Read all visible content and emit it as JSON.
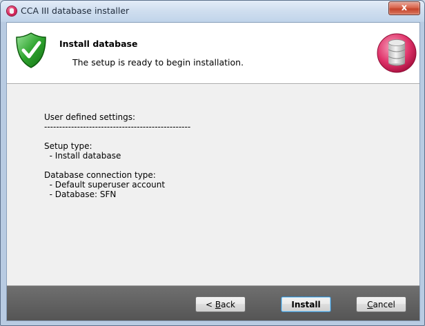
{
  "window": {
    "title": "CCA III database installer",
    "close_glyph": "x"
  },
  "header": {
    "title": "Install database",
    "subtitle": "The setup is ready to begin installation.",
    "left_icon": "shield-check-icon",
    "right_icon": "database-icon"
  },
  "summary": {
    "lines": [
      "User defined settings:",
      "-------------------------------------------------",
      "",
      "Setup type:",
      "  - Install database",
      "",
      "Database connection type:",
      "  - Default superuser account",
      "  - Database: SFN"
    ]
  },
  "buttons": {
    "back": {
      "pre": "< ",
      "accel": "B",
      "post": "ack"
    },
    "install": {
      "label": "Install"
    },
    "cancel": {
      "accel": "C",
      "post": "ancel"
    }
  },
  "colors": {
    "titlebar": "#c9daee",
    "close_button": "#c9452c",
    "footer": "#5e5e5e",
    "shield": "#2e9a2e",
    "database_ring": "#e0336a"
  }
}
